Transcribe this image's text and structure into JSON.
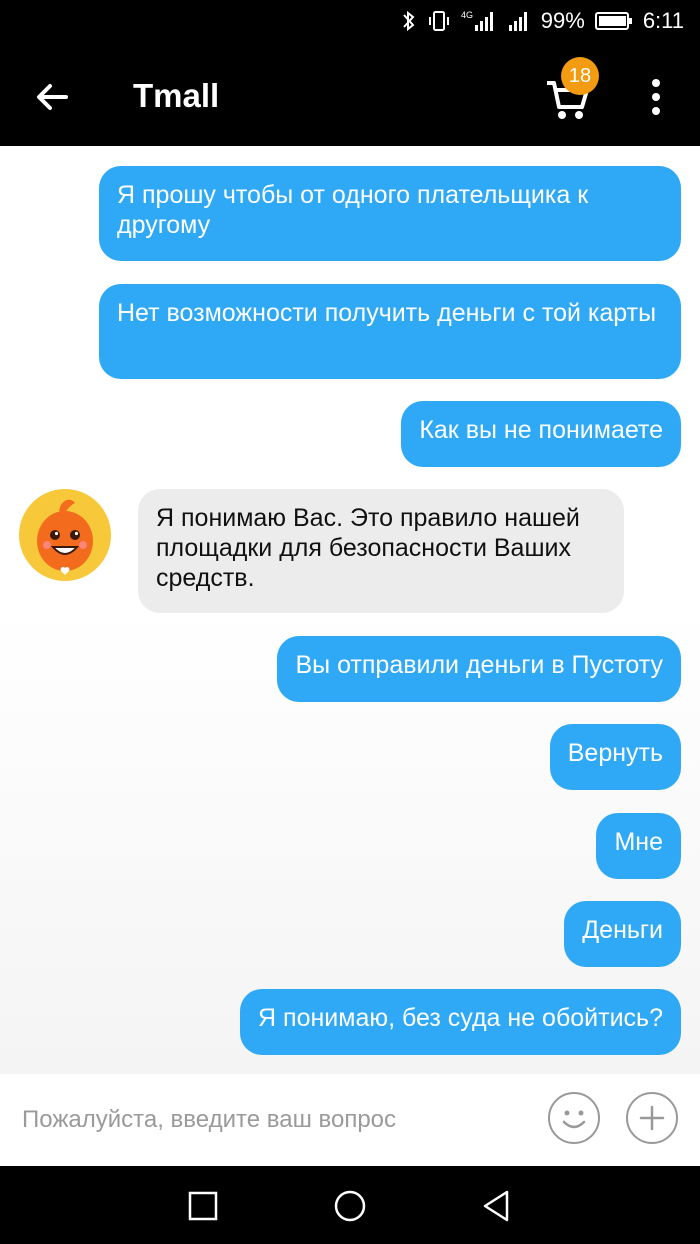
{
  "status_bar": {
    "battery": "99%",
    "time": "6:11",
    "network": "4G",
    "icons": [
      "bluetooth-icon",
      "vibrate-icon",
      "signal-icon",
      "battery-icon"
    ]
  },
  "header": {
    "title": "Tmall",
    "cart_count": "18",
    "icons": [
      "back-arrow-icon",
      "cart-icon",
      "more-vert-icon"
    ]
  },
  "messages": [
    {
      "side": "out",
      "text": "Я прошу чтобы от одного плательщика к другому"
    },
    {
      "side": "out",
      "text": "Нет возможности получить деньги с той карты"
    },
    {
      "side": "out",
      "text": "Как вы не понимаете"
    },
    {
      "side": "in",
      "text": "Я понимаю Вас. Это правило нашей площадки для безопасности Ваших средств."
    },
    {
      "side": "out",
      "text": "Вы отправили деньги в Пустоту"
    },
    {
      "side": "out",
      "text": "Вернуть"
    },
    {
      "side": "out",
      "text": "Мне"
    },
    {
      "side": "out",
      "text": "Деньги"
    },
    {
      "side": "out",
      "text": "Я понимаю, без суда не обойтись?"
    }
  ],
  "input": {
    "placeholder": "Пожалуйста, введите ваш вопрос",
    "value": ""
  },
  "colors": {
    "outgoing_bubble": "#2fa9f5",
    "incoming_bubble": "#ececec",
    "badge": "#f39c12",
    "avatar_bg": "#f7c83a"
  }
}
